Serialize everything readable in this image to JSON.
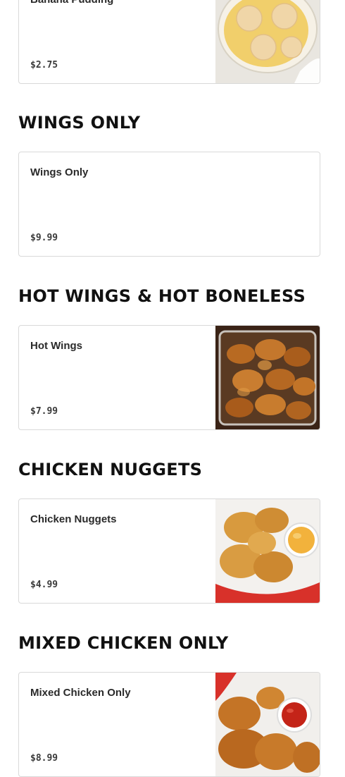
{
  "items": {
    "banana_pudding": {
      "name": "Banana Pudding",
      "price": "$2.75",
      "image": "banana-pudding-photo"
    },
    "wings_only": {
      "name": "Wings Only",
      "price": "$9.99"
    },
    "hot_wings": {
      "name": "Hot Wings",
      "price": "$7.99",
      "image": "hot-wings-photo"
    },
    "chicken_nuggets": {
      "name": "Chicken Nuggets",
      "price": "$4.99",
      "image": "chicken-nuggets-photo"
    },
    "mixed_chicken_only": {
      "name": "Mixed Chicken Only",
      "price": "$8.99",
      "image": "mixed-chicken-photo"
    }
  },
  "sections": {
    "wings_only": "WINGS ONLY",
    "hot_wings": "HOT WINGS & HOT BONELESS",
    "chicken_nuggets": "CHICKEN NUGGETS",
    "mixed_chicken": "MIXED CHICKEN ONLY"
  },
  "colors": {
    "card_border": "#d9d9d9",
    "heading": "#111111",
    "text": "#2a2a2a"
  }
}
